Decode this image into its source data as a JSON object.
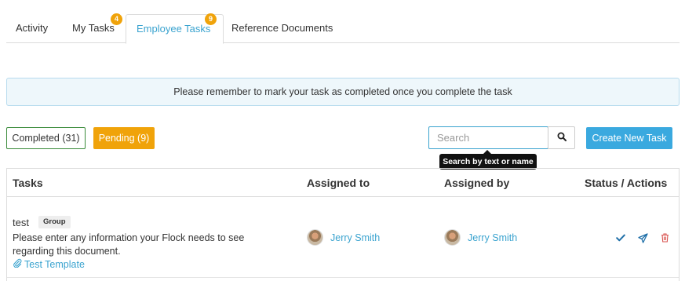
{
  "tabs": [
    {
      "label": "Activity",
      "badge": null
    },
    {
      "label": "My Tasks",
      "badge": "4"
    },
    {
      "label": "Employee Tasks",
      "badge": "9",
      "active": true
    },
    {
      "label": "Reference Documents",
      "badge": null
    }
  ],
  "notice": {
    "text": "Please remember to mark your task as completed once you complete the task"
  },
  "filters": {
    "completed_label": "Completed (31)",
    "pending_label": "Pending (9)"
  },
  "search": {
    "placeholder": "Search",
    "tooltip": "Search by text or name",
    "icon": "search-icon"
  },
  "create_button": {
    "label": "Create New Task"
  },
  "table": {
    "headers": {
      "tasks": "Tasks",
      "assigned_to": "Assigned to",
      "assigned_by": "Assigned by",
      "status_actions": "Status / Actions"
    },
    "rows": [
      {
        "name": "test",
        "badge": "Group",
        "description": "Please enter any information your Flock needs to see regarding this document.",
        "attachment": "Test Template",
        "assigned_to": "Jerry Smith",
        "assigned_by": "Jerry Smith",
        "actions": [
          "check-icon",
          "send-icon",
          "trash-icon"
        ]
      }
    ]
  },
  "colors": {
    "accent": "#3aa3cf",
    "pending": "#f0a30a",
    "completed_border": "#3a8b3a",
    "create": "#3aa9df",
    "delete": "#d9534f"
  }
}
